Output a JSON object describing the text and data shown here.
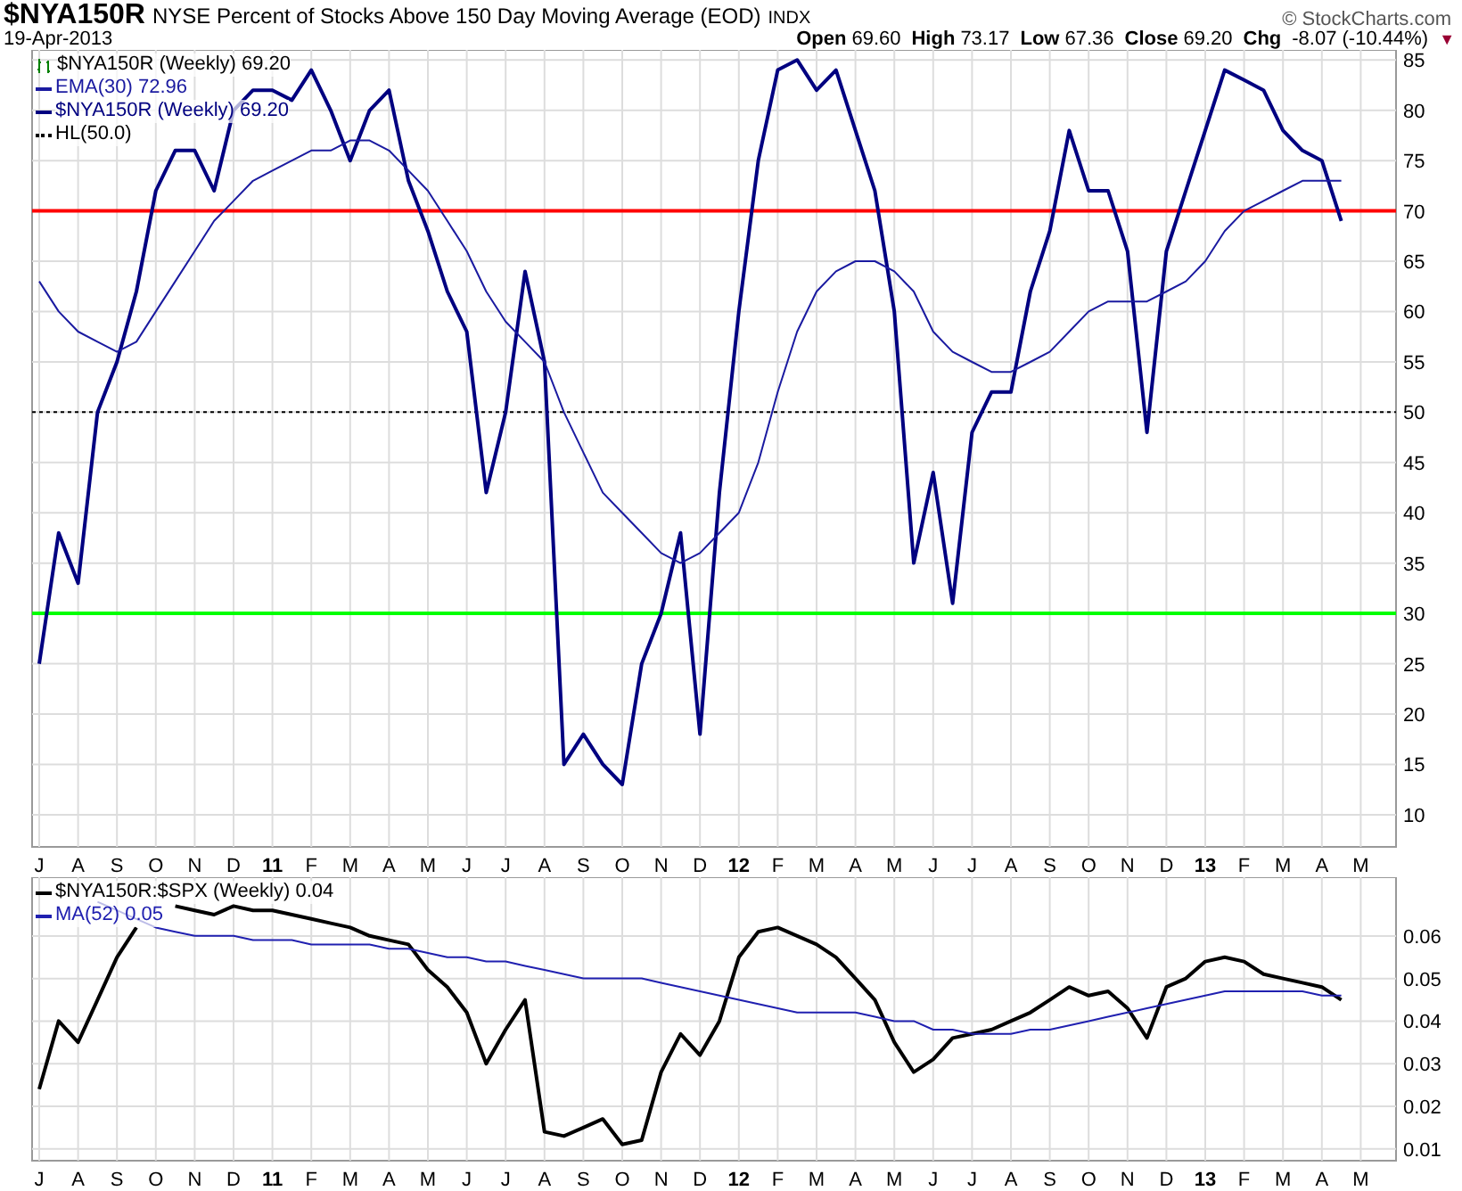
{
  "header": {
    "symbol": "$NYA150R",
    "description": "NYSE Percent of Stocks Above 150 Day Moving Average (EOD)",
    "exchange": "INDX",
    "credit": "© StockCharts.com",
    "date": "19-Apr-2013",
    "quote": [
      {
        "label": "Open",
        "value": "69.60"
      },
      {
        "label": "High",
        "value": "73.17"
      },
      {
        "label": "Low",
        "value": "67.36"
      },
      {
        "label": "Close",
        "value": "69.20"
      }
    ],
    "change": {
      "label": "Chg",
      "value": "-8.07 (-10.44%)",
      "marker": "▼"
    }
  },
  "panels": [
    {
      "legend": [
        {
          "kind": "bars",
          "text": "$NYA150R (Weekly) 69.20"
        },
        {
          "kind": "line",
          "text": "EMA(30) 72.96",
          "color": "#1a1aa0"
        },
        {
          "kind": "line",
          "text": "$NYA150R (Weekly) 69.20",
          "color": "#000080"
        },
        {
          "kind": "dotted",
          "text": "HL(50.0)",
          "color": "#000000"
        }
      ],
      "chart_data": {
        "type": "line",
        "categories": [
          "J",
          null,
          "A",
          null,
          "S",
          null,
          "O",
          null,
          "N",
          null,
          "D",
          null,
          "11",
          null,
          "F",
          null,
          "M",
          null,
          "A",
          null,
          "M",
          null,
          "J",
          null,
          "J",
          null,
          "A",
          null,
          "S",
          null,
          "O",
          null,
          "N",
          null,
          "D",
          null,
          "12",
          null,
          "F",
          null,
          "M",
          null,
          "A",
          null,
          "M",
          null,
          "J",
          null,
          "J",
          null,
          "A",
          null,
          "S",
          null,
          "O",
          null,
          "N",
          null,
          "D",
          null,
          "13",
          null,
          "F",
          null,
          "M",
          null,
          "A",
          null,
          "M"
        ],
        "series": [
          {
            "color": "#000080",
            "values": [
              25,
              38,
              33,
              50,
              55,
              62,
              72,
              76,
              76,
              72,
              80,
              82,
              82,
              81,
              84,
              80,
              75,
              80,
              82,
              73,
              68,
              62,
              58,
              42,
              50,
              64,
              55,
              15,
              18,
              15,
              13,
              25,
              30,
              38,
              18,
              42,
              60,
              75,
              84,
              85,
              82,
              84,
              78,
              72,
              60,
              35,
              44,
              31,
              48,
              52,
              52,
              62,
              68,
              78,
              72,
              72,
              66,
              48,
              66,
              72,
              78,
              84,
              83,
              82,
              78,
              76,
              75,
              69,
              null
            ]
          },
          {
            "color": "#1a1aa0",
            "values": [
              63,
              60,
              58,
              57,
              56,
              57,
              60,
              63,
              66,
              69,
              71,
              73,
              74,
              75,
              76,
              76,
              77,
              77,
              76,
              74,
              72,
              69,
              66,
              62,
              59,
              57,
              55,
              50,
              46,
              42,
              40,
              38,
              36,
              35,
              36,
              38,
              40,
              45,
              52,
              58,
              62,
              64,
              65,
              65,
              64,
              62,
              58,
              56,
              55,
              54,
              54,
              55,
              56,
              58,
              60,
              61,
              61,
              61,
              62,
              63,
              65,
              68,
              70,
              71,
              72,
              73,
              73,
              73,
              null
            ]
          }
        ],
        "ylim": [
          6.8,
          86
        ],
        "yticks": [
          10,
          15,
          20,
          25,
          30,
          35,
          40,
          45,
          50,
          55,
          60,
          65,
          70,
          75,
          80,
          85
        ],
        "grid": true,
        "ref_lines": [
          {
            "axis": "y",
            "value": 70,
            "color": "#ff0000"
          },
          {
            "axis": "y",
            "value": 50,
            "color": "#000000"
          },
          {
            "axis": "y",
            "value": 30,
            "color": "#00ff00"
          }
        ]
      }
    },
    {
      "legend": [
        {
          "kind": "line",
          "text": "$NYA150R:$SPX (Weekly) 0.04",
          "color": "#000000"
        },
        {
          "kind": "line",
          "text": "MA(52) 0.05",
          "color": "#2020b0"
        }
      ],
      "chart_data": {
        "type": "line",
        "categories": [
          "J",
          null,
          "A",
          null,
          "S",
          null,
          "O",
          null,
          "N",
          null,
          "D",
          null,
          "11",
          null,
          "F",
          null,
          "M",
          null,
          "A",
          null,
          "M",
          null,
          "J",
          null,
          "J",
          null,
          "A",
          null,
          "S",
          null,
          "O",
          null,
          "N",
          null,
          "D",
          null,
          "12",
          null,
          "F",
          null,
          "M",
          null,
          "A",
          null,
          "M",
          null,
          "J",
          null,
          "J",
          null,
          "A",
          null,
          "S",
          null,
          "O",
          null,
          "N",
          null,
          "D",
          null,
          "13",
          null,
          "F",
          null,
          "M",
          null,
          "A",
          null,
          "M"
        ],
        "series": [
          {
            "color": "#000000",
            "values": [
              0.024,
              0.04,
              0.035,
              0.045,
              0.055,
              0.062,
              null,
              0.067,
              0.066,
              0.065,
              0.067,
              0.066,
              0.066,
              0.065,
              0.064,
              0.063,
              0.062,
              0.06,
              0.059,
              0.058,
              0.052,
              0.048,
              0.042,
              0.03,
              0.038,
              0.045,
              0.014,
              0.013,
              0.015,
              0.017,
              0.011,
              0.012,
              0.028,
              0.037,
              0.032,
              0.04,
              0.055,
              0.061,
              0.062,
              0.06,
              0.058,
              0.055,
              0.05,
              0.045,
              0.035,
              0.028,
              0.031,
              0.036,
              0.037,
              0.038,
              0.04,
              0.042,
              0.045,
              0.048,
              0.046,
              0.047,
              0.043,
              0.036,
              0.048,
              0.05,
              0.054,
              0.055,
              0.054,
              0.051,
              0.05,
              0.049,
              0.048,
              0.045,
              null
            ]
          },
          {
            "color": "#2020b0",
            "values": [
              null,
              null,
              null,
              0.068,
              0.066,
              0.064,
              0.062,
              0.061,
              0.06,
              0.06,
              0.06,
              0.059,
              0.059,
              0.059,
              0.058,
              0.058,
              0.058,
              0.058,
              0.057,
              0.057,
              0.056,
              0.055,
              0.055,
              0.054,
              0.054,
              0.053,
              0.052,
              0.051,
              0.05,
              0.05,
              0.05,
              0.05,
              0.049,
              0.048,
              0.047,
              0.046,
              0.045,
              0.044,
              0.043,
              0.042,
              0.042,
              0.042,
              0.042,
              0.041,
              0.04,
              0.04,
              0.038,
              0.038,
              0.037,
              0.037,
              0.037,
              0.038,
              0.038,
              0.039,
              0.04,
              0.041,
              0.042,
              0.043,
              0.044,
              0.045,
              0.046,
              0.047,
              0.047,
              0.047,
              0.047,
              0.047,
              0.046,
              0.046,
              null
            ]
          }
        ],
        "grid": true,
        "ylim": [
          0.0072,
          0.0738
        ],
        "yticks": [
          {
            "value": 0.01,
            "label": "0.01"
          },
          {
            "value": 0.02,
            "label": "0.02"
          },
          {
            "value": 0.03,
            "label": "0.03"
          },
          {
            "value": 0.04,
            "label": "0.04"
          },
          {
            "value": 0.05,
            "label": "0.05"
          },
          {
            "value": 0.06,
            "label": "0.06"
          }
        ]
      }
    }
  ]
}
